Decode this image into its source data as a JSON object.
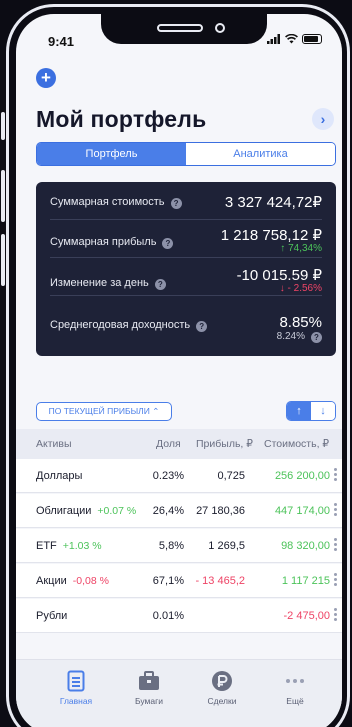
{
  "status_bar": {
    "time": "9:41"
  },
  "header": {
    "add_icon": "plus-icon",
    "title": "Мой портфель",
    "forward_icon": "chevron-right-icon"
  },
  "segmented": {
    "tabs": [
      {
        "label": "Портфель",
        "active": true
      },
      {
        "label": "Аналитика",
        "active": false
      }
    ]
  },
  "summary": {
    "rows": [
      {
        "label": "Суммарная стоимость",
        "value": "3 327 424,72₽",
        "sub": ""
      },
      {
        "label": "Суммарная прибыль",
        "value": "1 218 758,12 ₽",
        "sub": "↑ 74,34%"
      },
      {
        "label": "Изменение за день",
        "value": "-10 015.59 ₽",
        "sub": "↓ - 2.56%"
      },
      {
        "label": "Среднегодовая доходность",
        "value": "8.85%",
        "sub": "8.24%"
      }
    ]
  },
  "sort": {
    "label": "ПО ТЕКУЩЕЙ ПРИБЫЛИ ⌃",
    "asc_icon": "arrow-up-icon",
    "desc_icon": "arrow-down-icon"
  },
  "table": {
    "headers": [
      "Активы",
      "Доля",
      "Прибыль, ₽",
      "Стоимость, ₽"
    ],
    "rows": [
      {
        "name": "Доллары",
        "change": "",
        "share": "0.23%",
        "profit": "0,725",
        "value": "256 200,00"
      },
      {
        "name": "Облигации",
        "change": "+0.07 %",
        "share": "26,4%",
        "profit": "27 180,36",
        "value": "447 174,00"
      },
      {
        "name": "ETF",
        "change": "+1.03 %",
        "share": "5,8%",
        "profit": "1 269,5",
        "value": "98 320,00"
      },
      {
        "name": "Акции",
        "change": "-0,08 %",
        "share": "67,1%",
        "profit": "- 13 465,2",
        "value": "1 117 215"
      },
      {
        "name": "Рубли",
        "change": "",
        "share": "0.01%",
        "profit": "",
        "value": "-2 475,00"
      }
    ]
  },
  "tabbar": {
    "items": [
      {
        "label": "Главная",
        "icon": "home-doc-icon",
        "active": true
      },
      {
        "label": "Бумаги",
        "icon": "briefcase-icon",
        "active": false
      },
      {
        "label": "Сделки",
        "icon": "ruble-icon",
        "active": false
      },
      {
        "label": "Ещё",
        "icon": "more-dots-icon",
        "active": false
      }
    ]
  },
  "colors": {
    "accent": "#4a7ee8",
    "positive": "#4cc35a",
    "negative": "#ee4466",
    "card": "#1e2237"
  }
}
